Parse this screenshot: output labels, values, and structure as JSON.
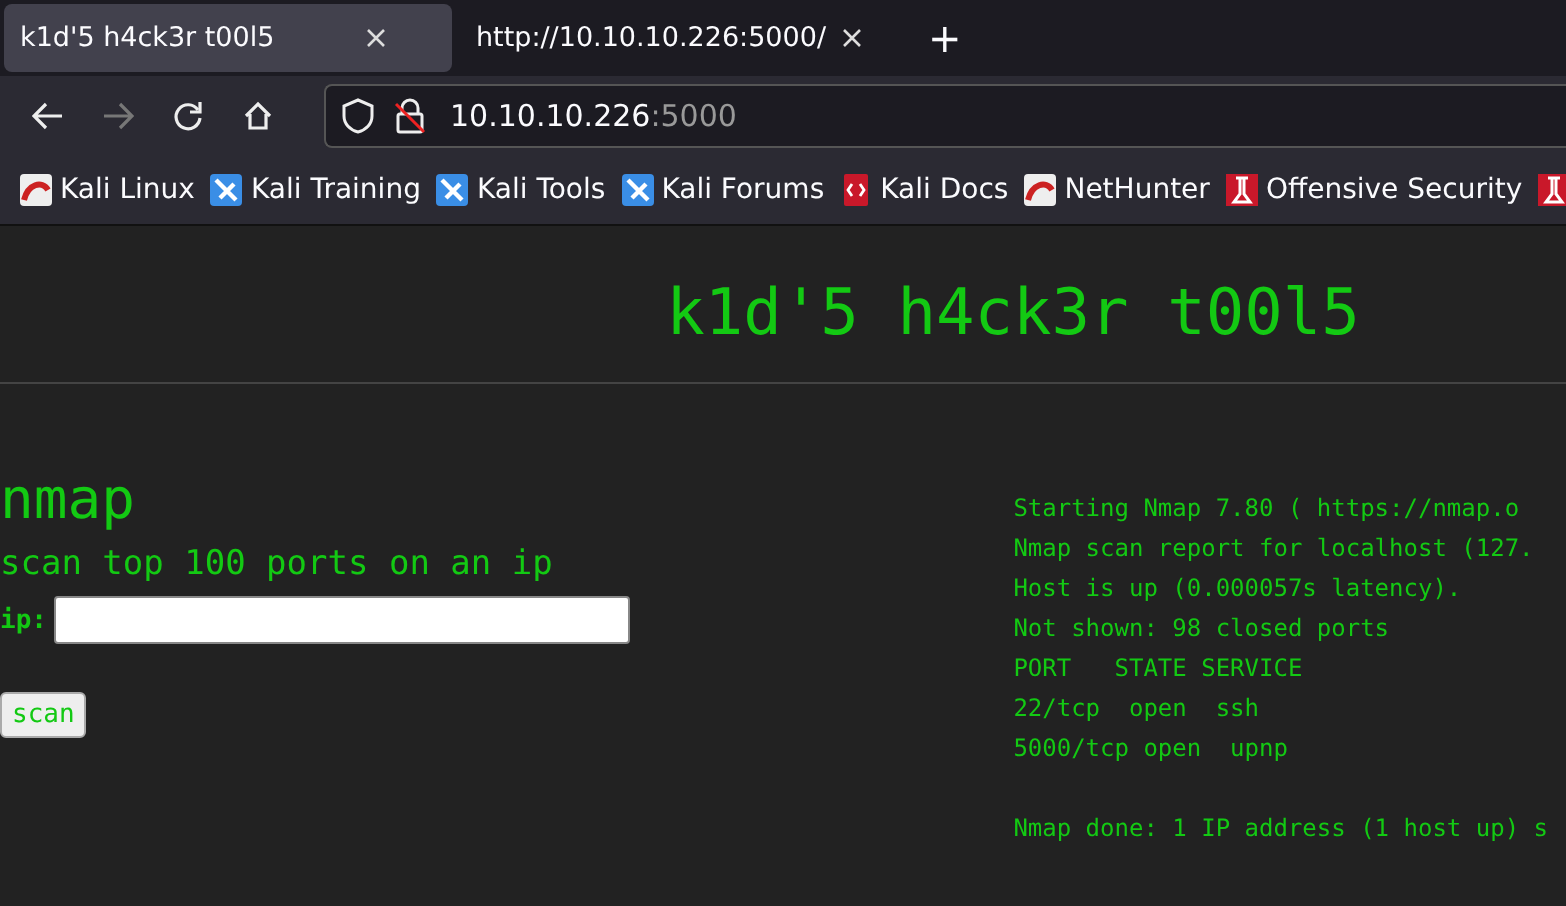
{
  "browser": {
    "tabs": [
      {
        "title": "k1d'5 h4ck3r t00l5",
        "selected": true
      },
      {
        "title": "http://10.10.10.226:5000/",
        "selected": false
      }
    ],
    "new_tab": "+",
    "address": {
      "host": "10.10.10.226",
      "port": ":5000"
    },
    "bookmarks": [
      {
        "label": "Kali Linux",
        "kind": "kali"
      },
      {
        "label": "Kali Training",
        "kind": "blue"
      },
      {
        "label": "Kali Tools",
        "kind": "blue"
      },
      {
        "label": "Kali Forums",
        "kind": "blue"
      },
      {
        "label": "Kali Docs",
        "kind": "docs"
      },
      {
        "label": "NetHunter",
        "kind": "kali"
      },
      {
        "label": "Offensive Security",
        "kind": "offsec"
      },
      {
        "kind": "offsec"
      }
    ]
  },
  "page": {
    "title": "k1d'5 h4ck3r t00l5",
    "tool": {
      "heading": "nmap",
      "description": "scan top 100 ports on an ip",
      "field_label": "ip:",
      "button": "scan"
    },
    "output": [
      [
        "Starting Nmap 7.80 ( https://nmap.o",
        "Nmap scan report for localhost (127.",
        "Host is up (0.000057s latency).",
        "Not shown: 98 closed ports",
        "PORT   STATE SERVICE",
        "22/tcp  open  ssh",
        "5000/tcp open  upnp"
      ],
      [
        "Nmap done: 1 IP address (1 host up) s"
      ]
    ]
  }
}
